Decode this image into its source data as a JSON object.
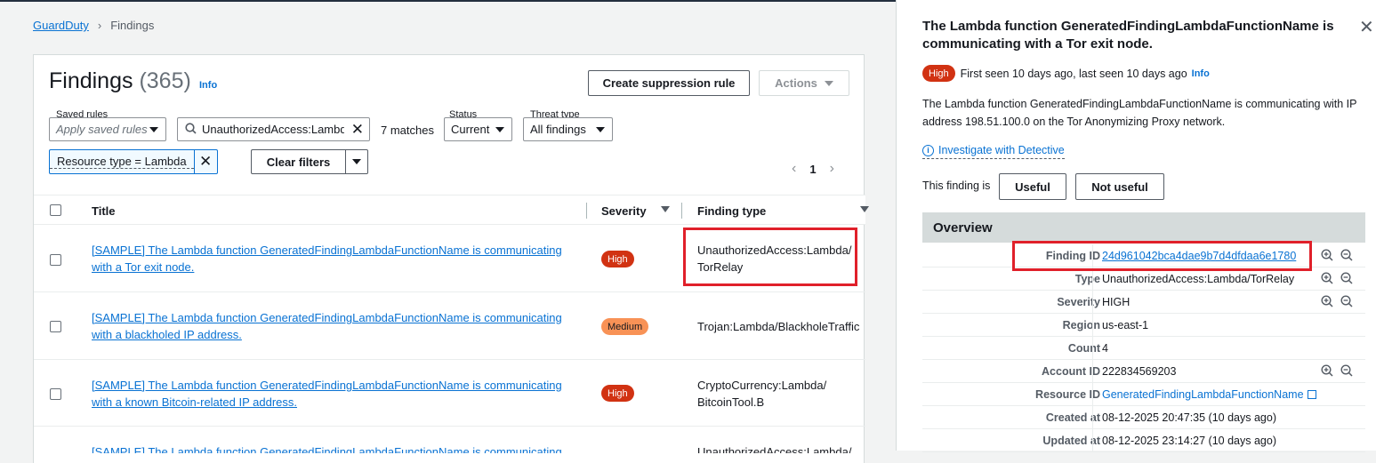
{
  "breadcrumb": {
    "root": "GuardDuty",
    "current": "Findings"
  },
  "findings": {
    "title": "Findings",
    "count": "(365)",
    "info": "Info",
    "create_suppression": "Create suppression rule",
    "actions": "Actions",
    "saved_rules_label": "Saved rules",
    "saved_rules_placeholder": "Apply saved rules",
    "search_value": "UnauthorizedAccess:Lambda/TorRelay",
    "matches": "7 matches",
    "status_label": "Status",
    "status_value": "Current",
    "threat_label": "Threat type",
    "threat_value": "All findings",
    "filter_token": "Resource type = Lambda",
    "clear_filters": "Clear filters",
    "page": "1",
    "columns": {
      "title": "Title",
      "severity": "Severity",
      "finding_type": "Finding type"
    },
    "rows": [
      {
        "title": "[SAMPLE] The Lambda function GeneratedFindingLambdaFunctionName is communicating with a Tor exit node.",
        "severity": "High",
        "type": "UnauthorizedAccess:Lambda/ TorRelay"
      },
      {
        "title": "[SAMPLE] The Lambda function GeneratedFindingLambdaFunctionName is communicating with a blackholed IP address.",
        "severity": "Medium",
        "type": "Trojan:Lambda/BlackholeTraffic"
      },
      {
        "title": "[SAMPLE] The Lambda function GeneratedFindingLambdaFunctionName is communicating with a known Bitcoin-related IP address.",
        "severity": "High",
        "type": "CryptoCurrency:Lambda/ BitcoinTool.B"
      },
      {
        "title": "[SAMPLE] The Lambda function GeneratedFindingLambdaFunctionName is communicating",
        "severity": "",
        "type": "UnauthorizedAccess:Lambda/"
      }
    ]
  },
  "drawer": {
    "title": "The Lambda function GeneratedFindingLambdaFunctionName is communicating with a Tor exit node.",
    "severity_badge": "High",
    "seen": "First seen 10 days ago, last seen 10 days ago",
    "info": "Info",
    "description": "The Lambda function GeneratedFindingLambdaFunctionName is communicating with IP address 198.51.100.0 on the Tor Anonymizing Proxy network.",
    "detective": "Investigate with Detective",
    "useful_prompt": "This finding is",
    "useful": "Useful",
    "not_useful": "Not useful",
    "overview_title": "Overview",
    "overview": [
      {
        "label": "Finding ID",
        "value": "24d961042bca4dae9b7d4dfdaa6e1780"
      },
      {
        "label": "Type",
        "value": "UnauthorizedAccess:Lambda/TorRelay"
      },
      {
        "label": "Severity",
        "value": "HIGH"
      },
      {
        "label": "Region",
        "value": "us-east-1"
      },
      {
        "label": "Count",
        "value": "4"
      },
      {
        "label": "Account ID",
        "value": "222834569203"
      },
      {
        "label": "Resource ID",
        "value": "GeneratedFindingLambdaFunctionName"
      },
      {
        "label": "Created at",
        "value": "08-12-2025 20:47:35 (10 days ago)"
      },
      {
        "label": "Updated at",
        "value": "08-12-2025 23:14:27 (10 days ago)"
      }
    ]
  },
  "colors": {
    "link": "#0972d3",
    "high": "#d13212",
    "medium": "#f89256",
    "highlight": "#e0202a"
  }
}
